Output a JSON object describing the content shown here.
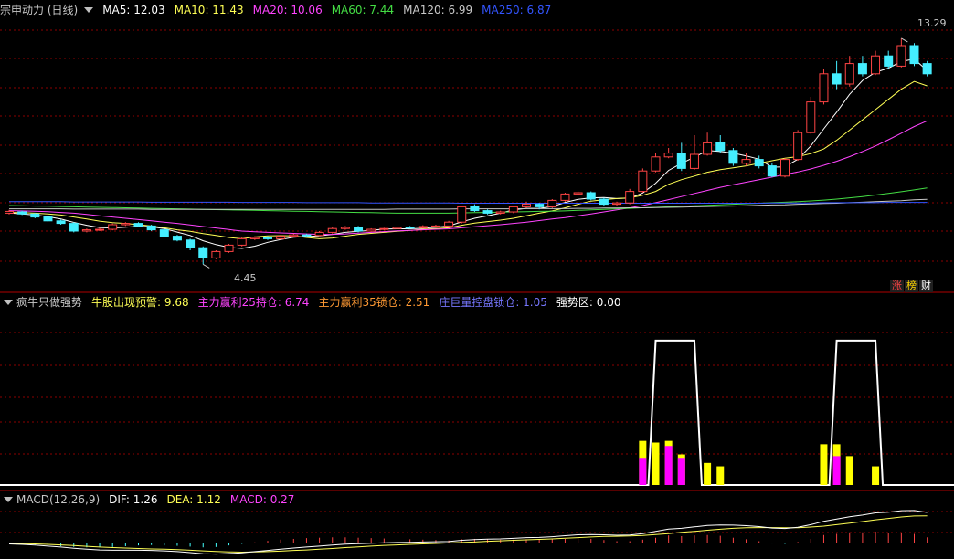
{
  "main_header": {
    "title": "宗申动力 (日线)",
    "items": [
      {
        "label": "MA5: 12.03",
        "color": "#ffffff"
      },
      {
        "label": "MA10: 11.43",
        "color": "#ffff55"
      },
      {
        "label": "MA20: 10.06",
        "color": "#ff44ff"
      },
      {
        "label": "MA60: 7.44",
        "color": "#44dd44"
      },
      {
        "label": "MA120: 6.99",
        "color": "#c8c8c8"
      },
      {
        "label": "MA250: 6.87",
        "color": "#3355ff"
      }
    ]
  },
  "price_labels": {
    "high": "13.29",
    "low": "4.45"
  },
  "badges": [
    {
      "label": "涨",
      "color": "#ff4444"
    },
    {
      "label": "榜",
      "color": "#ffd700"
    },
    {
      "label": "财",
      "color": "#ffffff"
    }
  ],
  "indicator_header": {
    "title": "疯牛只做强势",
    "items": [
      {
        "label": "牛股出现预警: 9.68",
        "color": "#ffff55"
      },
      {
        "label": "主力赢利25持仓: 6.74",
        "color": "#ff44ff"
      },
      {
        "label": "主力赢利35锁仓: 2.51",
        "color": "#ff9933"
      },
      {
        "label": "庄巨量控盘锁仓: 1.05",
        "color": "#7777ff"
      },
      {
        "label": "强势区: 0.00",
        "color": "#ffffff"
      }
    ]
  },
  "macd_header": {
    "title": "MACD(12,26,9)",
    "items": [
      {
        "label": "DIF: 1.26",
        "color": "#ffffff"
      },
      {
        "label": "DEA: 1.12",
        "color": "#ffff55"
      },
      {
        "label": "MACD: 0.27",
        "color": "#ff44ff"
      }
    ]
  },
  "colors": {
    "up": "#ff4444",
    "down": "#44eeff",
    "grid": "#8b0000"
  },
  "chart_data": {
    "type": "candlestick",
    "price_range": [
      4.0,
      14.0
    ],
    "candles": [
      [
        6.45,
        6.52,
        6.58,
        6.4
      ],
      [
        6.5,
        6.42,
        6.55,
        6.38
      ],
      [
        6.42,
        6.3,
        6.46,
        6.25
      ],
      [
        6.3,
        6.15,
        6.34,
        6.1
      ],
      [
        6.15,
        6.05,
        6.2,
        6.0
      ],
      [
        6.05,
        5.75,
        6.1,
        5.7
      ],
      [
        5.75,
        5.8,
        5.85,
        5.7
      ],
      [
        5.8,
        5.82,
        5.88,
        5.75
      ],
      [
        5.82,
        6.0,
        6.05,
        5.78
      ],
      [
        6.0,
        6.05,
        6.1,
        5.95
      ],
      [
        6.05,
        5.95,
        6.1,
        5.9
      ],
      [
        5.95,
        5.8,
        6.0,
        5.75
      ],
      [
        5.8,
        5.55,
        5.85,
        5.5
      ],
      [
        5.55,
        5.4,
        5.6,
        5.35
      ],
      [
        5.4,
        5.1,
        5.45,
        5.0
      ],
      [
        5.1,
        4.7,
        5.15,
        4.45
      ],
      [
        4.7,
        4.95,
        5.0,
        4.65
      ],
      [
        4.95,
        5.2,
        5.25,
        4.9
      ],
      [
        5.2,
        5.45,
        5.5,
        5.15
      ],
      [
        5.45,
        5.5,
        5.55,
        5.4
      ],
      [
        5.5,
        5.45,
        5.55,
        5.4
      ],
      [
        5.45,
        5.55,
        5.6,
        5.4
      ],
      [
        5.55,
        5.6,
        5.65,
        5.5
      ],
      [
        5.6,
        5.58,
        5.65,
        5.52
      ],
      [
        5.58,
        5.7,
        5.75,
        5.55
      ],
      [
        5.7,
        5.85,
        5.9,
        5.65
      ],
      [
        5.85,
        5.9,
        5.95,
        5.8
      ],
      [
        5.9,
        5.75,
        5.95,
        5.7
      ],
      [
        5.75,
        5.82,
        5.86,
        5.72
      ],
      [
        5.82,
        5.85,
        5.88,
        5.78
      ],
      [
        5.85,
        5.9,
        5.95,
        5.82
      ],
      [
        5.9,
        5.88,
        5.95,
        5.84
      ],
      [
        5.88,
        5.93,
        5.98,
        5.85
      ],
      [
        5.93,
        5.95,
        6.0,
        5.9
      ],
      [
        5.95,
        6.1,
        6.15,
        5.92
      ],
      [
        6.1,
        6.7,
        6.75,
        6.05
      ],
      [
        6.7,
        6.55,
        6.8,
        6.5
      ],
      [
        6.55,
        6.45,
        6.6,
        6.4
      ],
      [
        6.45,
        6.5,
        6.55,
        6.4
      ],
      [
        6.5,
        6.7,
        6.75,
        6.45
      ],
      [
        6.7,
        6.8,
        6.9,
        6.65
      ],
      [
        6.8,
        6.7,
        6.85,
        6.6
      ],
      [
        6.7,
        6.95,
        7.0,
        6.65
      ],
      [
        6.95,
        7.2,
        7.25,
        6.9
      ],
      [
        7.2,
        7.25,
        7.3,
        7.15
      ],
      [
        7.25,
        7.0,
        7.3,
        6.95
      ],
      [
        7.0,
        6.8,
        7.05,
        6.75
      ],
      [
        6.8,
        6.85,
        6.9,
        6.75
      ],
      [
        6.85,
        7.3,
        7.4,
        6.8
      ],
      [
        7.3,
        8.1,
        8.2,
        7.25
      ],
      [
        8.1,
        8.65,
        8.8,
        8.05
      ],
      [
        8.65,
        8.8,
        9.0,
        8.6
      ],
      [
        8.8,
        8.2,
        9.2,
        8.1
      ],
      [
        8.2,
        8.75,
        9.5,
        8.15
      ],
      [
        8.75,
        9.2,
        9.6,
        8.7
      ],
      [
        9.2,
        8.9,
        9.5,
        8.8
      ],
      [
        8.9,
        8.4,
        9.0,
        8.3
      ],
      [
        8.4,
        8.55,
        8.8,
        8.3
      ],
      [
        8.55,
        8.3,
        8.7,
        8.2
      ],
      [
        8.3,
        7.9,
        8.4,
        7.85
      ],
      [
        7.9,
        8.55,
        8.6,
        7.85
      ],
      [
        8.55,
        9.6,
        9.7,
        8.5
      ],
      [
        9.6,
        10.8,
        11.0,
        9.55
      ],
      [
        10.8,
        11.9,
        12.1,
        10.7
      ],
      [
        11.9,
        11.5,
        12.4,
        11.3
      ],
      [
        11.5,
        12.3,
        12.6,
        11.4
      ],
      [
        12.3,
        11.9,
        12.6,
        11.8
      ],
      [
        11.9,
        12.6,
        12.8,
        11.85
      ],
      [
        12.6,
        12.2,
        12.8,
        12.1
      ],
      [
        12.2,
        13.0,
        13.29,
        12.15
      ],
      [
        13.0,
        12.3,
        13.1,
        12.2
      ],
      [
        12.3,
        11.9,
        12.4,
        11.8
      ]
    ],
    "ma": [
      {
        "name": "MA5",
        "color": "#ffffff",
        "values": [
          6.46,
          6.42,
          6.38,
          6.31,
          6.22,
          6.09,
          5.98,
          5.89,
          5.87,
          5.9,
          5.94,
          5.92,
          5.85,
          5.71,
          5.58,
          5.37,
          5.22,
          5.11,
          5.07,
          5.16,
          5.31,
          5.42,
          5.51,
          5.54,
          5.56,
          5.62,
          5.7,
          5.74,
          5.78,
          5.83,
          5.84,
          5.84,
          5.86,
          5.9,
          5.95,
          6.11,
          6.25,
          6.35,
          6.45,
          6.58,
          6.64,
          6.64,
          6.71,
          6.87,
          6.99,
          7.05,
          7.06,
          7.02,
          7.04,
          7.24,
          7.62,
          8.12,
          8.4,
          8.64,
          8.9,
          8.86,
          8.8,
          8.69,
          8.56,
          8.25,
          8.26,
          8.56,
          9.08,
          9.75,
          10.4,
          11.1,
          11.64,
          11.96,
          12.12,
          12.38,
          12.48,
          12.03
        ]
      },
      {
        "name": "MA10",
        "color": "#ffff55",
        "values": [
          6.48,
          6.47,
          6.45,
          6.42,
          6.38,
          6.3,
          6.22,
          6.14,
          6.08,
          6.05,
          6.0,
          5.95,
          5.88,
          5.8,
          5.74,
          5.65,
          5.58,
          5.5,
          5.45,
          5.52,
          5.56,
          5.57,
          5.56,
          5.5,
          5.45,
          5.48,
          5.55,
          5.62,
          5.66,
          5.7,
          5.74,
          5.78,
          5.82,
          5.85,
          5.88,
          5.98,
          6.06,
          6.12,
          6.18,
          6.25,
          6.35,
          6.45,
          6.54,
          6.66,
          6.8,
          6.92,
          6.98,
          7.02,
          7.05,
          7.15,
          7.3,
          7.58,
          7.76,
          7.9,
          8.05,
          8.15,
          8.22,
          8.3,
          8.4,
          8.5,
          8.6,
          8.66,
          8.78,
          8.96,
          9.3,
          9.7,
          10.1,
          10.5,
          10.9,
          11.3,
          11.6,
          11.43
        ]
      },
      {
        "name": "MA20",
        "color": "#ff44ff",
        "values": [
          6.55,
          6.54,
          6.53,
          6.51,
          6.48,
          6.45,
          6.4,
          6.35,
          6.3,
          6.25,
          6.2,
          6.15,
          6.1,
          6.05,
          5.99,
          5.93,
          5.87,
          5.81,
          5.75,
          5.72,
          5.7,
          5.68,
          5.66,
          5.64,
          5.62,
          5.62,
          5.64,
          5.67,
          5.7,
          5.73,
          5.76,
          5.78,
          5.8,
          5.82,
          5.84,
          5.88,
          5.92,
          5.96,
          6.0,
          6.05,
          6.1,
          6.16,
          6.22,
          6.28,
          6.35,
          6.42,
          6.5,
          6.58,
          6.66,
          6.75,
          6.86,
          6.98,
          7.1,
          7.22,
          7.34,
          7.46,
          7.56,
          7.66,
          7.76,
          7.86,
          7.96,
          8.06,
          8.18,
          8.32,
          8.48,
          8.66,
          8.86,
          9.08,
          9.32,
          9.58,
          9.84,
          10.06
        ]
      },
      {
        "name": "MA60",
        "color": "#44dd44",
        "values": [
          6.75,
          6.74,
          6.73,
          6.72,
          6.71,
          6.7,
          6.69,
          6.68,
          6.67,
          6.66,
          6.65,
          6.64,
          6.63,
          6.62,
          6.61,
          6.6,
          6.59,
          6.58,
          6.57,
          6.56,
          6.55,
          6.54,
          6.53,
          6.52,
          6.51,
          6.5,
          6.49,
          6.48,
          6.47,
          6.46,
          6.45,
          6.45,
          6.45,
          6.45,
          6.45,
          6.46,
          6.47,
          6.48,
          6.49,
          6.5,
          6.51,
          6.52,
          6.53,
          6.54,
          6.56,
          6.58,
          6.6,
          6.62,
          6.64,
          6.66,
          6.68,
          6.7,
          6.72,
          6.74,
          6.76,
          6.78,
          6.8,
          6.82,
          6.84,
          6.86,
          6.88,
          6.9,
          6.93,
          6.96,
          7.0,
          7.05,
          7.1,
          7.16,
          7.22,
          7.29,
          7.36,
          7.44
        ]
      },
      {
        "name": "MA120",
        "color": "#c8c8c8",
        "values": [
          6.62,
          6.62,
          6.62,
          6.62,
          6.62,
          6.61,
          6.61,
          6.61,
          6.61,
          6.61,
          6.61,
          6.6,
          6.6,
          6.6,
          6.6,
          6.6,
          6.6,
          6.6,
          6.6,
          6.6,
          6.6,
          6.6,
          6.6,
          6.6,
          6.6,
          6.6,
          6.6,
          6.6,
          6.6,
          6.6,
          6.61,
          6.61,
          6.61,
          6.61,
          6.61,
          6.62,
          6.62,
          6.62,
          6.62,
          6.62,
          6.63,
          6.63,
          6.63,
          6.63,
          6.64,
          6.64,
          6.65,
          6.65,
          6.66,
          6.66,
          6.67,
          6.68,
          6.69,
          6.7,
          6.71,
          6.72,
          6.73,
          6.74,
          6.76,
          6.77,
          6.78,
          6.8,
          6.81,
          6.83,
          6.84,
          6.86,
          6.88,
          6.9,
          6.92,
          6.94,
          6.97,
          6.99
        ]
      },
      {
        "name": "MA250",
        "color": "#3355ff",
        "values": [
          6.9,
          6.9,
          6.9,
          6.9,
          6.9,
          6.89,
          6.89,
          6.89,
          6.89,
          6.89,
          6.89,
          6.88,
          6.88,
          6.88,
          6.88,
          6.88,
          6.88,
          6.88,
          6.87,
          6.87,
          6.87,
          6.87,
          6.87,
          6.86,
          6.86,
          6.86,
          6.86,
          6.86,
          6.85,
          6.85,
          6.85,
          6.85,
          6.85,
          6.85,
          6.85,
          6.84,
          6.84,
          6.84,
          6.84,
          6.84,
          6.84,
          6.84,
          6.84,
          6.84,
          6.84,
          6.84,
          6.84,
          6.84,
          6.84,
          6.84,
          6.84,
          6.84,
          6.84,
          6.84,
          6.84,
          6.84,
          6.84,
          6.84,
          6.84,
          6.85,
          6.85,
          6.85,
          6.85,
          6.86,
          6.86,
          6.86,
          6.86,
          6.86,
          6.87,
          6.87,
          6.87,
          6.87
        ]
      }
    ],
    "indicator": {
      "range": [
        0,
        10
      ],
      "zones": [
        [
          50,
          53
        ],
        [
          64,
          67
        ]
      ],
      "bars": [
        {
          "i": 49,
          "yellow": 2.6,
          "magenta": 1.6
        },
        {
          "i": 50,
          "yellow": 2.5
        },
        {
          "i": 51,
          "yellow": 2.6,
          "magenta": 2.3
        },
        {
          "i": 52,
          "yellow": 1.8,
          "magenta": 1.6
        },
        {
          "i": 54,
          "yellow": 1.3
        },
        {
          "i": 55,
          "yellow": 1.1
        },
        {
          "i": 63,
          "yellow": 2.4
        },
        {
          "i": 64,
          "yellow": 2.4,
          "magenta": 1.7
        },
        {
          "i": 65,
          "yellow": 1.7
        },
        {
          "i": 67,
          "yellow": 1.1
        }
      ]
    },
    "macd": {
      "range": [
        -0.6,
        1.6
      ],
      "dif": [
        -0.05,
        -0.07,
        -0.1,
        -0.14,
        -0.18,
        -0.23,
        -0.27,
        -0.3,
        -0.31,
        -0.31,
        -0.31,
        -0.32,
        -0.34,
        -0.37,
        -0.41,
        -0.46,
        -0.47,
        -0.45,
        -0.42,
        -0.37,
        -0.32,
        -0.27,
        -0.22,
        -0.18,
        -0.14,
        -0.1,
        -0.06,
        -0.04,
        -0.02,
        0.0,
        0.01,
        0.02,
        0.03,
        0.04,
        0.05,
        0.1,
        0.13,
        0.15,
        0.16,
        0.18,
        0.21,
        0.22,
        0.25,
        0.29,
        0.33,
        0.34,
        0.33,
        0.31,
        0.32,
        0.38,
        0.47,
        0.57,
        0.6,
        0.66,
        0.72,
        0.74,
        0.73,
        0.71,
        0.67,
        0.61,
        0.59,
        0.64,
        0.75,
        0.89,
        0.98,
        1.08,
        1.15,
        1.24,
        1.27,
        1.33,
        1.34,
        1.26
      ],
      "dea": [
        -0.03,
        -0.04,
        -0.05,
        -0.07,
        -0.09,
        -0.12,
        -0.15,
        -0.18,
        -0.2,
        -0.22,
        -0.24,
        -0.26,
        -0.27,
        -0.29,
        -0.31,
        -0.34,
        -0.36,
        -0.38,
        -0.39,
        -0.38,
        -0.37,
        -0.35,
        -0.32,
        -0.3,
        -0.27,
        -0.24,
        -0.2,
        -0.17,
        -0.14,
        -0.11,
        -0.09,
        -0.07,
        -0.05,
        -0.03,
        -0.01,
        0.01,
        0.03,
        0.06,
        0.08,
        0.1,
        0.12,
        0.14,
        0.16,
        0.19,
        0.21,
        0.24,
        0.26,
        0.27,
        0.28,
        0.3,
        0.34,
        0.38,
        0.43,
        0.47,
        0.52,
        0.56,
        0.6,
        0.62,
        0.63,
        0.63,
        0.62,
        0.62,
        0.65,
        0.69,
        0.75,
        0.81,
        0.88,
        0.95,
        1.01,
        1.07,
        1.11,
        1.12
      ]
    }
  }
}
